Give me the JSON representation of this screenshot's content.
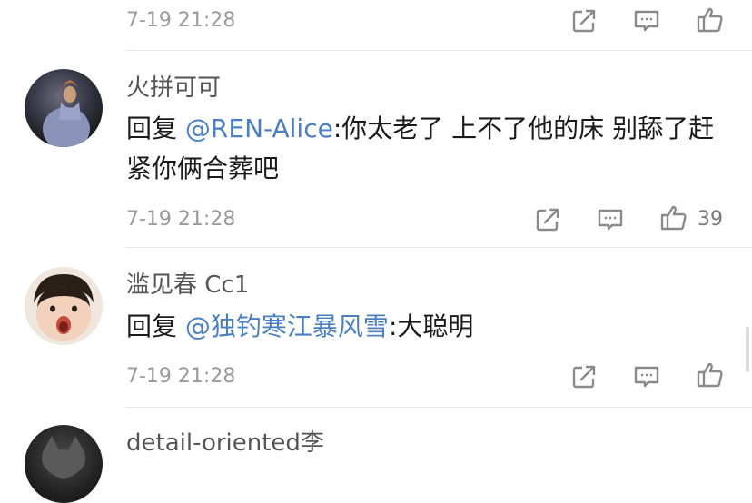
{
  "comments": [
    {
      "time": "7-19 21:28",
      "likes": ""
    },
    {
      "name": "火拼可可",
      "reply_prefix": "回复",
      "mention": "@REN-Alice",
      "text": ":你太老了 上不了他的床 别舔了赶紧你俩合葬吧",
      "time": "7-19 21:28",
      "likes": "39"
    },
    {
      "name": "滥见春 Cc1",
      "reply_prefix": "回复",
      "mention": "@独钓寒江暴风雪",
      "text": ":大聪明",
      "time": "7-19 21:28",
      "likes": ""
    },
    {
      "name": "detail-oriented李"
    }
  ],
  "icons": {
    "share": "share-icon",
    "comment": "comment-icon",
    "like": "thumbs-up-icon"
  },
  "colors": {
    "mention": "#4a7fc1",
    "name": "#555555",
    "time": "#9a9a9a",
    "icon": "#8a8a8a"
  }
}
